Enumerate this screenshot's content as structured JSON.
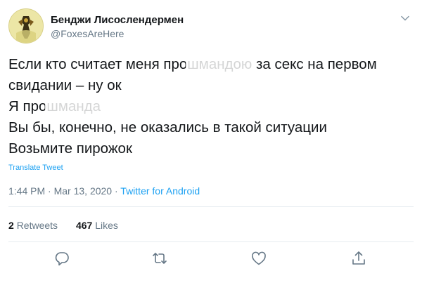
{
  "user": {
    "display_name": "Бенджи Лисослендермен",
    "handle": "@FoxesAreHere"
  },
  "tweet": {
    "lines": [
      {
        "before": "Если кто считает меня про",
        "obscured": "шмандою",
        "after": " за секс на первом"
      },
      {
        "text": "свидании – ну ок"
      },
      {
        "before": "Я про",
        "obscured": "шманда",
        "after": ""
      },
      {
        "text": "Вы бы, конечно, не оказались в такой ситуации"
      },
      {
        "text": "Возьмите пирожок"
      }
    ],
    "translate_label": "Translate Tweet"
  },
  "meta": {
    "time": "1:44 PM",
    "separator": " · ",
    "date": "Mar 13, 2020",
    "source": "Twitter for Android"
  },
  "stats": {
    "retweets_count": "2",
    "retweets_label": "Retweets",
    "likes_count": "467",
    "likes_label": "Likes"
  },
  "icons": {
    "reply": "reply-icon",
    "retweet": "retweet-icon",
    "like": "like-icon",
    "share": "share-icon",
    "menu": "chevron-down-icon"
  },
  "colors": {
    "accent": "#1da1f2",
    "muted": "#657786",
    "text": "#14171a",
    "divider": "#e6ecf0"
  }
}
